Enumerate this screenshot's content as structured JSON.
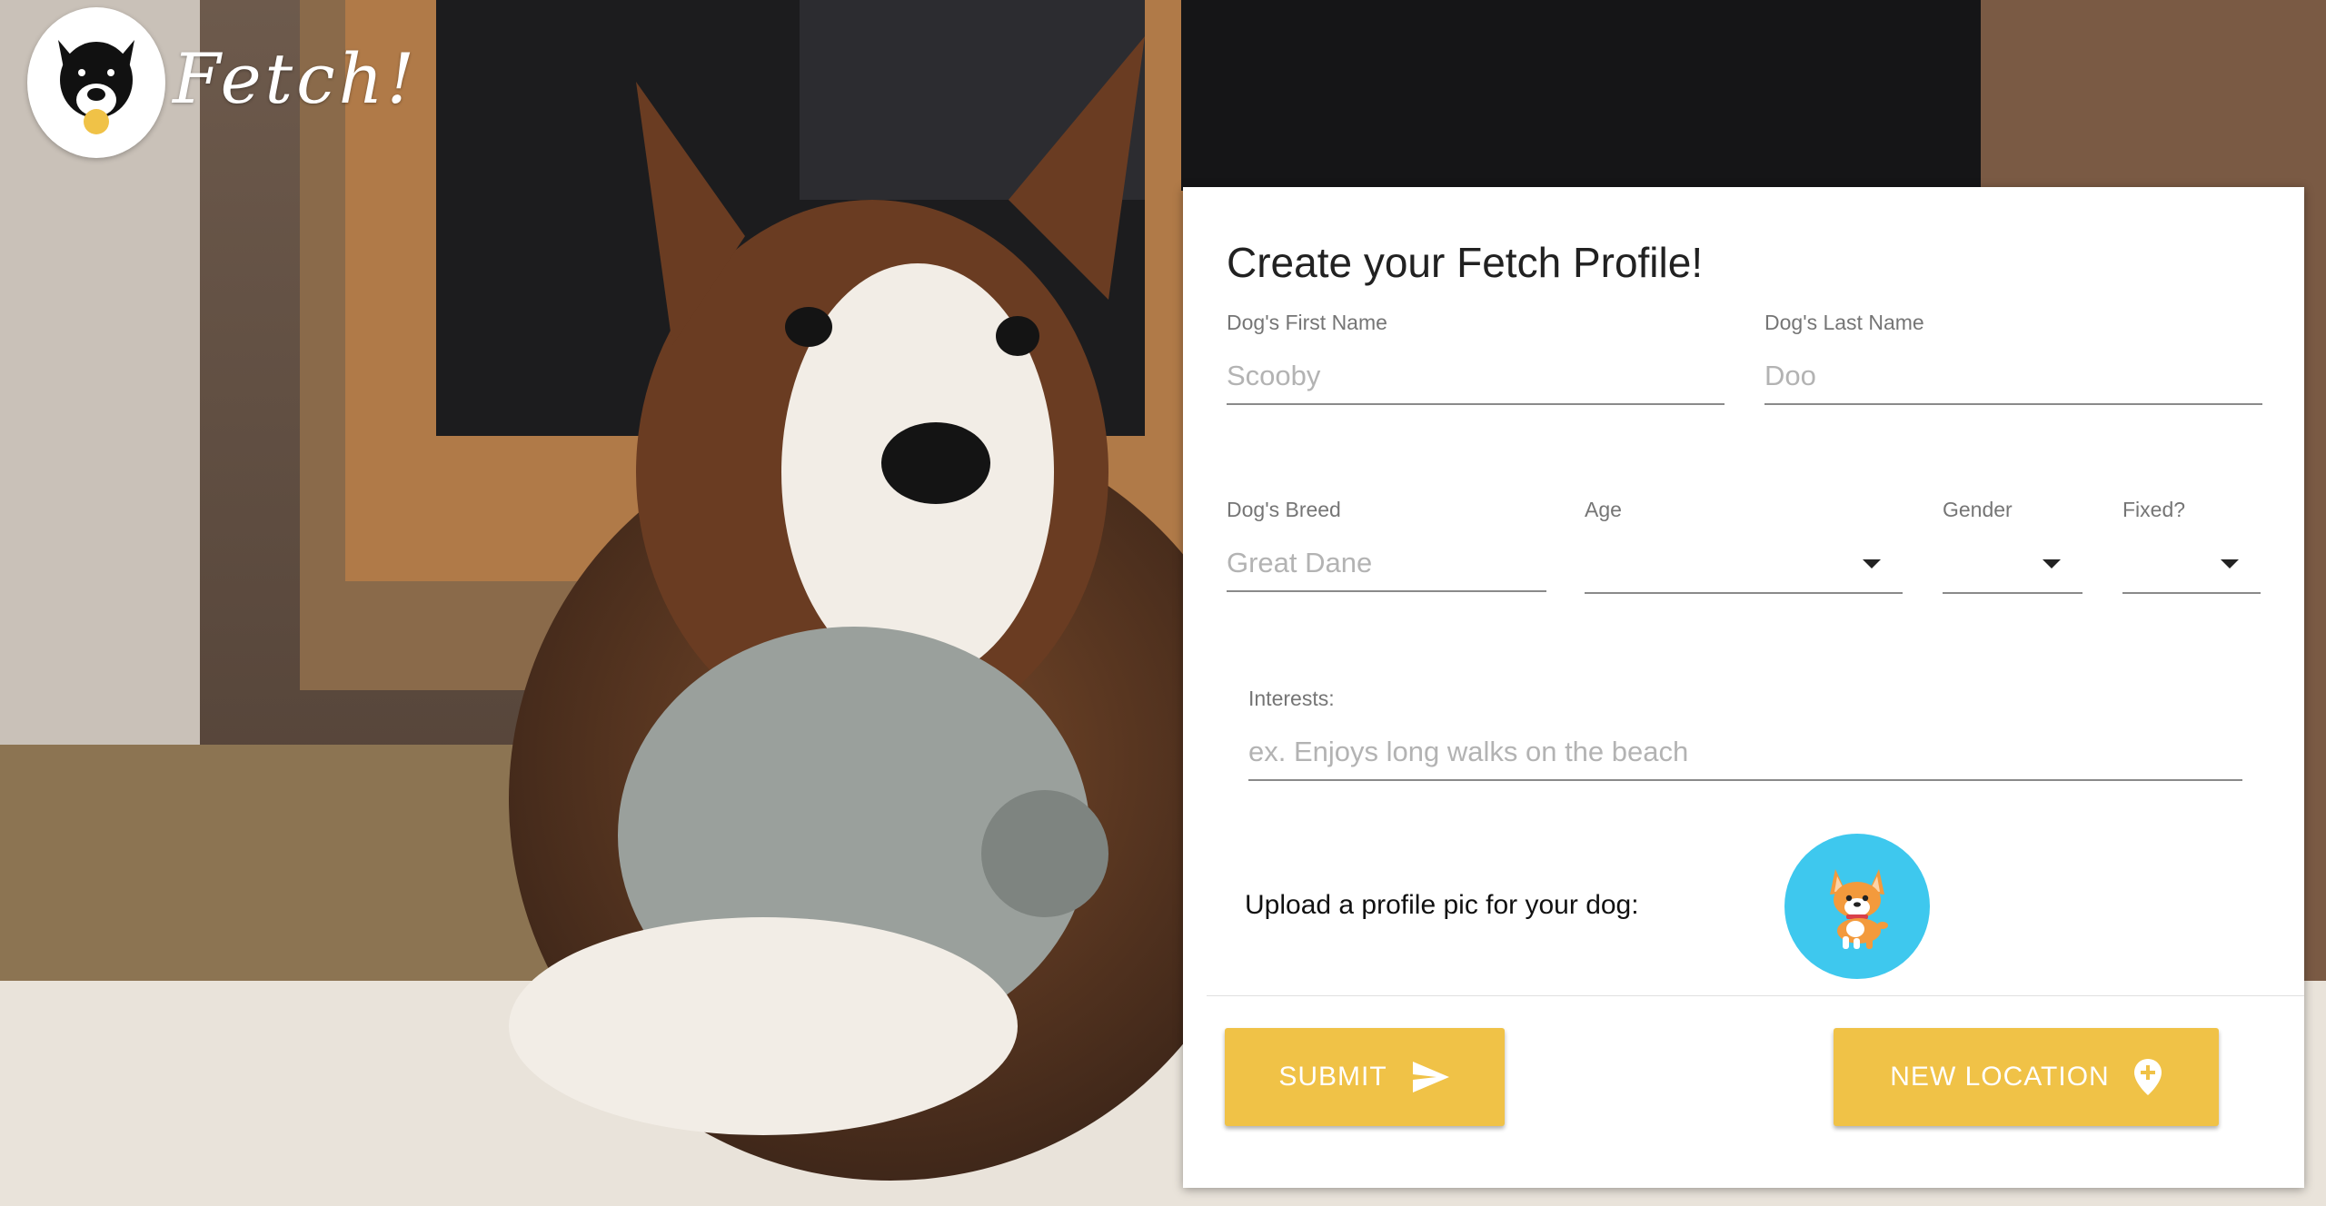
{
  "brand": {
    "name": "Fetch!",
    "logo_icon": "dog-face-icon"
  },
  "form": {
    "title": "Create your Fetch Profile!",
    "first_name": {
      "label": "Dog's First Name",
      "placeholder": "Scooby",
      "value": ""
    },
    "last_name": {
      "label": "Dog's Last Name",
      "placeholder": "Doo",
      "value": ""
    },
    "breed": {
      "label": "Dog's Breed",
      "placeholder": "Great Dane",
      "value": ""
    },
    "age": {
      "label": "Age",
      "value": ""
    },
    "gender": {
      "label": "Gender",
      "value": ""
    },
    "fixed": {
      "label": "Fixed?",
      "value": ""
    },
    "interests": {
      "label": "Interests:",
      "placeholder": "ex. Enjoys long walks on the beach",
      "value": ""
    },
    "upload": {
      "label": "Upload a profile pic for your dog:",
      "avatar_icon": "corgi-icon"
    }
  },
  "actions": {
    "submit_label": "SUBMIT",
    "submit_icon": "send-icon",
    "new_location_label": "NEW LOCATION",
    "new_location_icon": "add-location-icon"
  },
  "colors": {
    "button": "#f0c247",
    "avatar_bg": "#3ec8ee",
    "card_bg": "#ffffff"
  }
}
